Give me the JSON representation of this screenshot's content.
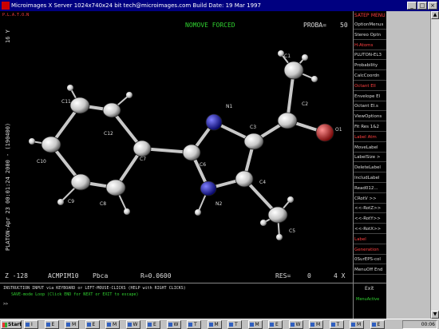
{
  "window": {
    "title": "Microimages X Server  1024x740x24 bit  tech@microimages.com  Build Date: 19 Mar 1997",
    "buttons": [
      "_",
      "□",
      "×"
    ]
  },
  "canvas_title": "P.L.A.T.O.N",
  "plot": {
    "mode_label": "NOMOVE FORCED",
    "proba_label": "PROBA=",
    "proba_value": "50",
    "vertical_left": "PLATON-Apr 23 00:01:24 2000 - (190400)",
    "vertical_right": "16 Y",
    "bottom": {
      "z": "Z -128",
      "name": "ACMPIM10",
      "space_group": "Pbca",
      "r_value": "R=0.0600",
      "res_label": "RES=",
      "res_value": "0",
      "right": "4 X"
    },
    "atoms": {
      "c1": "C1",
      "c2": "C2",
      "o1": "O1",
      "n1": "N1",
      "c3": "C3",
      "c4": "C4",
      "c5": "C5",
      "c6": "C6",
      "n2": "N2",
      "c7": "C7",
      "c8": "C8",
      "c9": "C9",
      "c10": "C10",
      "c11": "C11",
      "c12": "C12"
    }
  },
  "menu": {
    "header": [
      "SATEP",
      "MENU"
    ],
    "items": [
      {
        "label": "OptionMenus",
        "color": "#dddddd"
      },
      {
        "label": "Stereo Optn",
        "color": "#dddddd"
      },
      {
        "label": "H-Atoms",
        "color": "#ff4040"
      },
      {
        "label": "PLUTON-EL3",
        "color": "#dddddd"
      },
      {
        "label": "Probability",
        "color": "#dddddd"
      },
      {
        "label": "CalcCoordn",
        "color": "#dddddd"
      },
      {
        "label": "Octant Ell",
        "color": "#ff4040"
      },
      {
        "label": "Envelope El",
        "color": "#dddddd"
      },
      {
        "label": "Octant El.s",
        "color": "#dddddd"
      },
      {
        "label": "ViewOptions",
        "color": "#dddddd"
      },
      {
        "label": "Fit Res 1&2",
        "color": "#dddddd"
      },
      {
        "label": "Label Atm",
        "color": "#ff4040"
      },
      {
        "label": "MoveLabel",
        "color": "#dddddd"
      },
      {
        "label": "LabelSize >",
        "color": "#dddddd"
      },
      {
        "label": "DeleteLabel",
        "color": "#dddddd"
      },
      {
        "label": "IncludLabel",
        "color": "#dddddd"
      },
      {
        "label": "Read012...",
        "color": "#dddddd"
      },
      {
        "label": "CRotV >>",
        "color": "#dddddd"
      },
      {
        "label": "<<-RotZ>>",
        "color": "#dddddd"
      },
      {
        "label": "<<-RotY>>",
        "color": "#dddddd"
      },
      {
        "label": "<<-RotX>>",
        "color": "#dddddd"
      },
      {
        "label": "Label",
        "color": "#ff4040"
      },
      {
        "label": "Generation",
        "color": "#ff4040"
      },
      {
        "label": "0SurEPS-col",
        "color": "#dddddd"
      },
      {
        "label": "MenuOff End",
        "color": "#dddddd"
      }
    ],
    "exit_label": "Exit",
    "menu_active": "MenuActive"
  },
  "command": {
    "line1": "INSTRUCTION INPUT via KEYBOARD or LEFT-MOUSE-CLICKS (HELP with RIGHT CLICKS)",
    "line2": "SAVE-mode Loop (Click END for NEXT or EXIT to escape)",
    "prompt": ">>"
  },
  "taskbar": {
    "start": "Start",
    "tasks": [
      "I",
      "E",
      "M",
      "E",
      "M",
      "W",
      "E",
      "W",
      "T",
      "M",
      "T",
      "M",
      "E",
      "W",
      "M",
      "T",
      "M",
      "E"
    ],
    "clock": "00:06"
  }
}
